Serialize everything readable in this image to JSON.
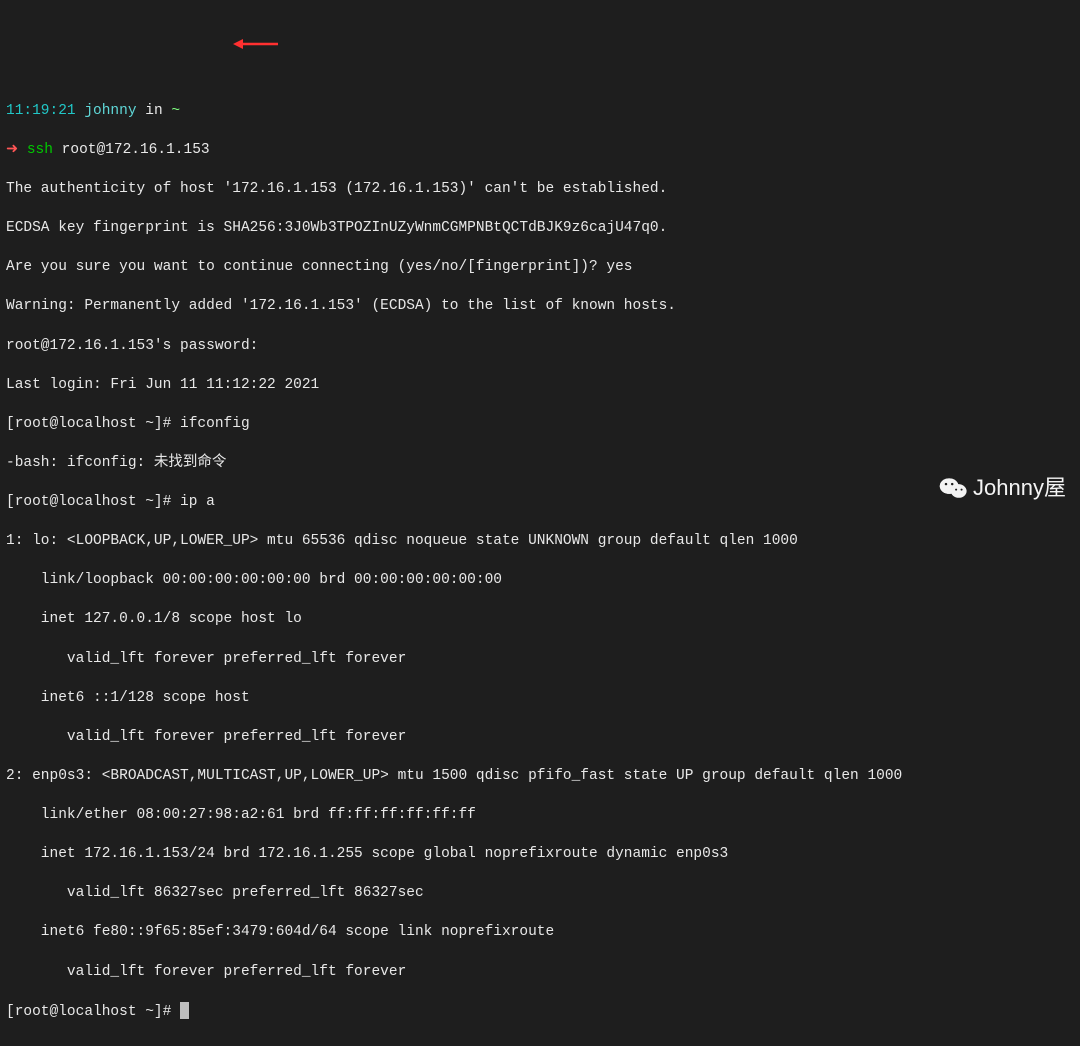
{
  "prompt1": {
    "time": "11:19:21",
    "user": "johnny",
    "sep": " in ",
    "path": "~",
    "symbol": "➜ ",
    "cmd_ssh": "ssh",
    "cmd_arg": " root@172.16.1.153"
  },
  "output": {
    "l1": "The authenticity of host '172.16.1.153 (172.16.1.153)' can't be established.",
    "l2": "ECDSA key fingerprint is SHA256:3J0Wb3TPOZInUZyWnmCGMPNBtQCTdBJK9z6cajU47q0.",
    "l3": "Are you sure you want to continue connecting (yes/no/[fingerprint])? yes",
    "l4": "Warning: Permanently added '172.16.1.153' (ECDSA) to the list of known hosts.",
    "l5": "root@172.16.1.153's password:",
    "l6": "Last login: Fri Jun 11 11:12:22 2021",
    "l7": "[root@localhost ~]# ifconfig",
    "l8": "-bash: ifconfig: 未找到命令",
    "l9": "[root@localhost ~]# ip a",
    "l10": "1: lo: <LOOPBACK,UP,LOWER_UP> mtu 65536 qdisc noqueue state UNKNOWN group default qlen 1000",
    "l11": "    link/loopback 00:00:00:00:00:00 brd 00:00:00:00:00:00",
    "l12": "    inet 127.0.0.1/8 scope host lo",
    "l13": "       valid_lft forever preferred_lft forever",
    "l14": "    inet6 ::1/128 scope host",
    "l15": "       valid_lft forever preferred_lft forever",
    "l16": "2: enp0s3: <BROADCAST,MULTICAST,UP,LOWER_UP> mtu 1500 qdisc pfifo_fast state UP group default qlen 1000",
    "l17": "    link/ether 08:00:27:98:a2:61 brd ff:ff:ff:ff:ff:ff",
    "l18": "    inet 172.16.1.153/24 brd 172.16.1.255 scope global noprefixroute dynamic enp0s3",
    "l19": "       valid_lft 86327sec preferred_lft 86327sec",
    "l20": "    inet6 fe80::9f65:85ef:3479:604d/64 scope link noprefixroute",
    "l21": "       valid_lft forever preferred_lft forever",
    "l22": "[root@localhost ~]# "
  },
  "watermark": {
    "text": "Johnny屋"
  }
}
